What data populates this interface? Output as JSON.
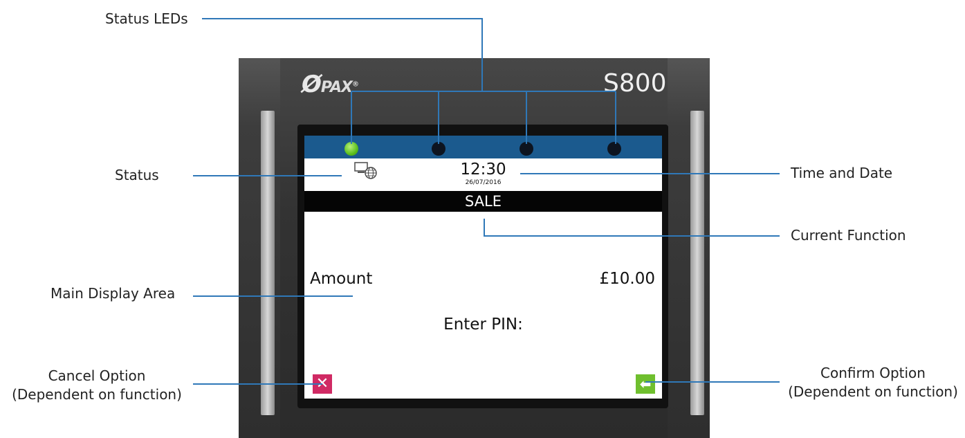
{
  "callouts": {
    "status_leds": "Status LEDs",
    "status": "Status",
    "time_and_date": "Time and Date",
    "current_function": "Current Function",
    "main_display_area": "Main Display Area",
    "cancel_option": "Cancel Option",
    "cancel_option_note": "(Dependent on function)",
    "confirm_option": "Confirm Option",
    "confirm_option_note": "(Dependent on function)"
  },
  "device": {
    "brand": "PAX",
    "model": "S800"
  },
  "screen": {
    "leds": [
      {
        "name": "led-1",
        "on": true,
        "color": "#5cbf1e"
      },
      {
        "name": "led-2",
        "on": false
      },
      {
        "name": "led-3",
        "on": false
      },
      {
        "name": "led-4",
        "on": false
      }
    ],
    "status_icon": "network-globe-icon",
    "time": "12:30",
    "date": "26/07/2016",
    "function": "SALE",
    "amount_label": "Amount",
    "amount_value": "£10.00",
    "prompt": "Enter PIN:",
    "cancel_icon": "close-icon",
    "confirm_icon": "enter-arrow-icon"
  },
  "colors": {
    "led_bar": "#1b5a8e",
    "leader_lines": "#2f78b8",
    "cancel_button": "#d02a64",
    "confirm_button": "#6fbf2e"
  }
}
